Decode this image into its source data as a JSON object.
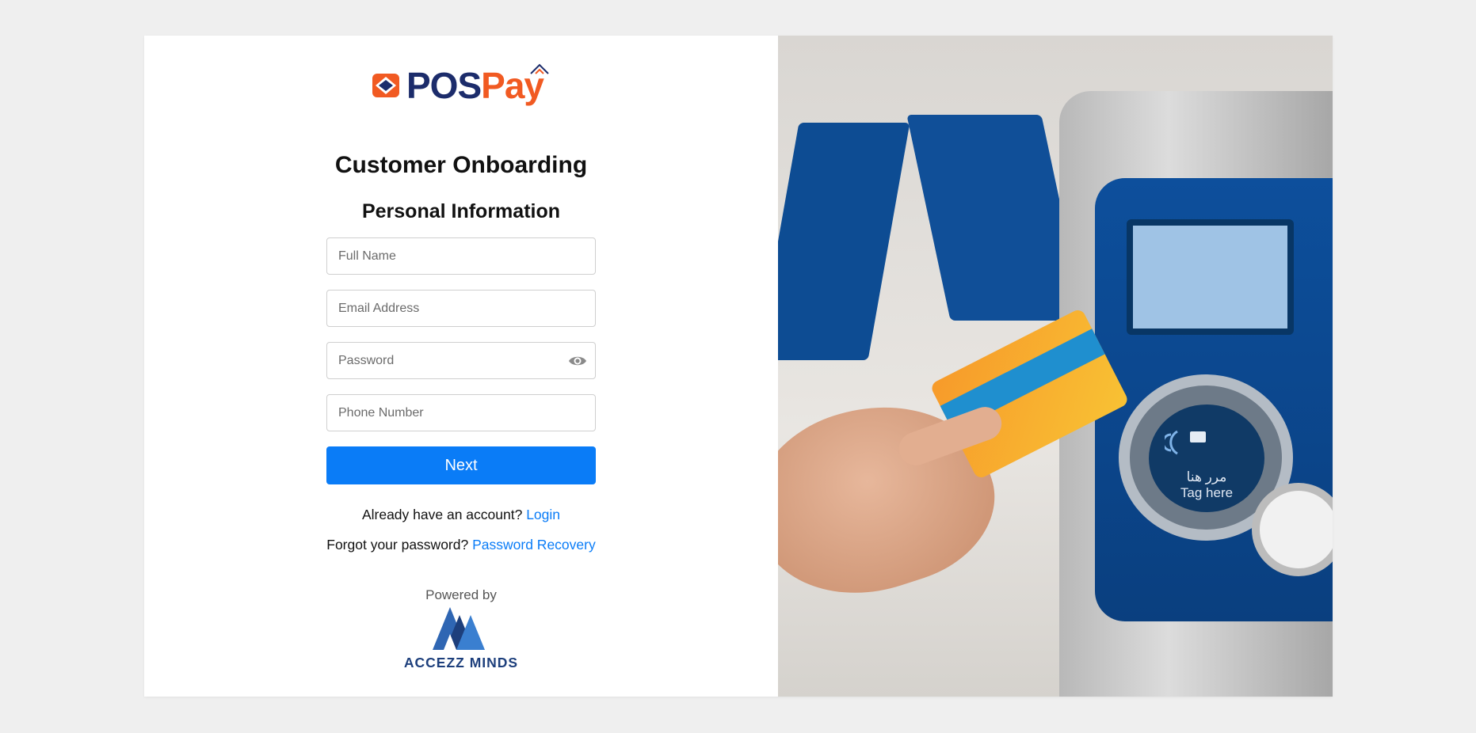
{
  "brand": {
    "logo_text_a": "POS",
    "logo_text_b": "Pay",
    "logo_color_a": "#1c2c6b",
    "logo_color_b": "#f15a22"
  },
  "form": {
    "title": "Customer Onboarding",
    "subtitle": "Personal Information",
    "fields": {
      "full_name_placeholder": "Full Name",
      "email_placeholder": "Email Address",
      "password_placeholder": "Password",
      "phone_placeholder": "Phone Number"
    },
    "next_label": "Next",
    "accent_color": "#0a7cf7"
  },
  "links": {
    "account_prompt": "Already have an account?",
    "login_label": "Login",
    "forgot_prompt": "Forgot your password?",
    "recovery_label": "Password Recovery"
  },
  "footer": {
    "powered_by": "Powered by",
    "company_name": "ACCEZZ MINDS"
  },
  "photo": {
    "reader_text_ar": "مرر هنا",
    "reader_text_en": "Tag here"
  },
  "icons": {
    "password_toggle": "eye-icon"
  }
}
